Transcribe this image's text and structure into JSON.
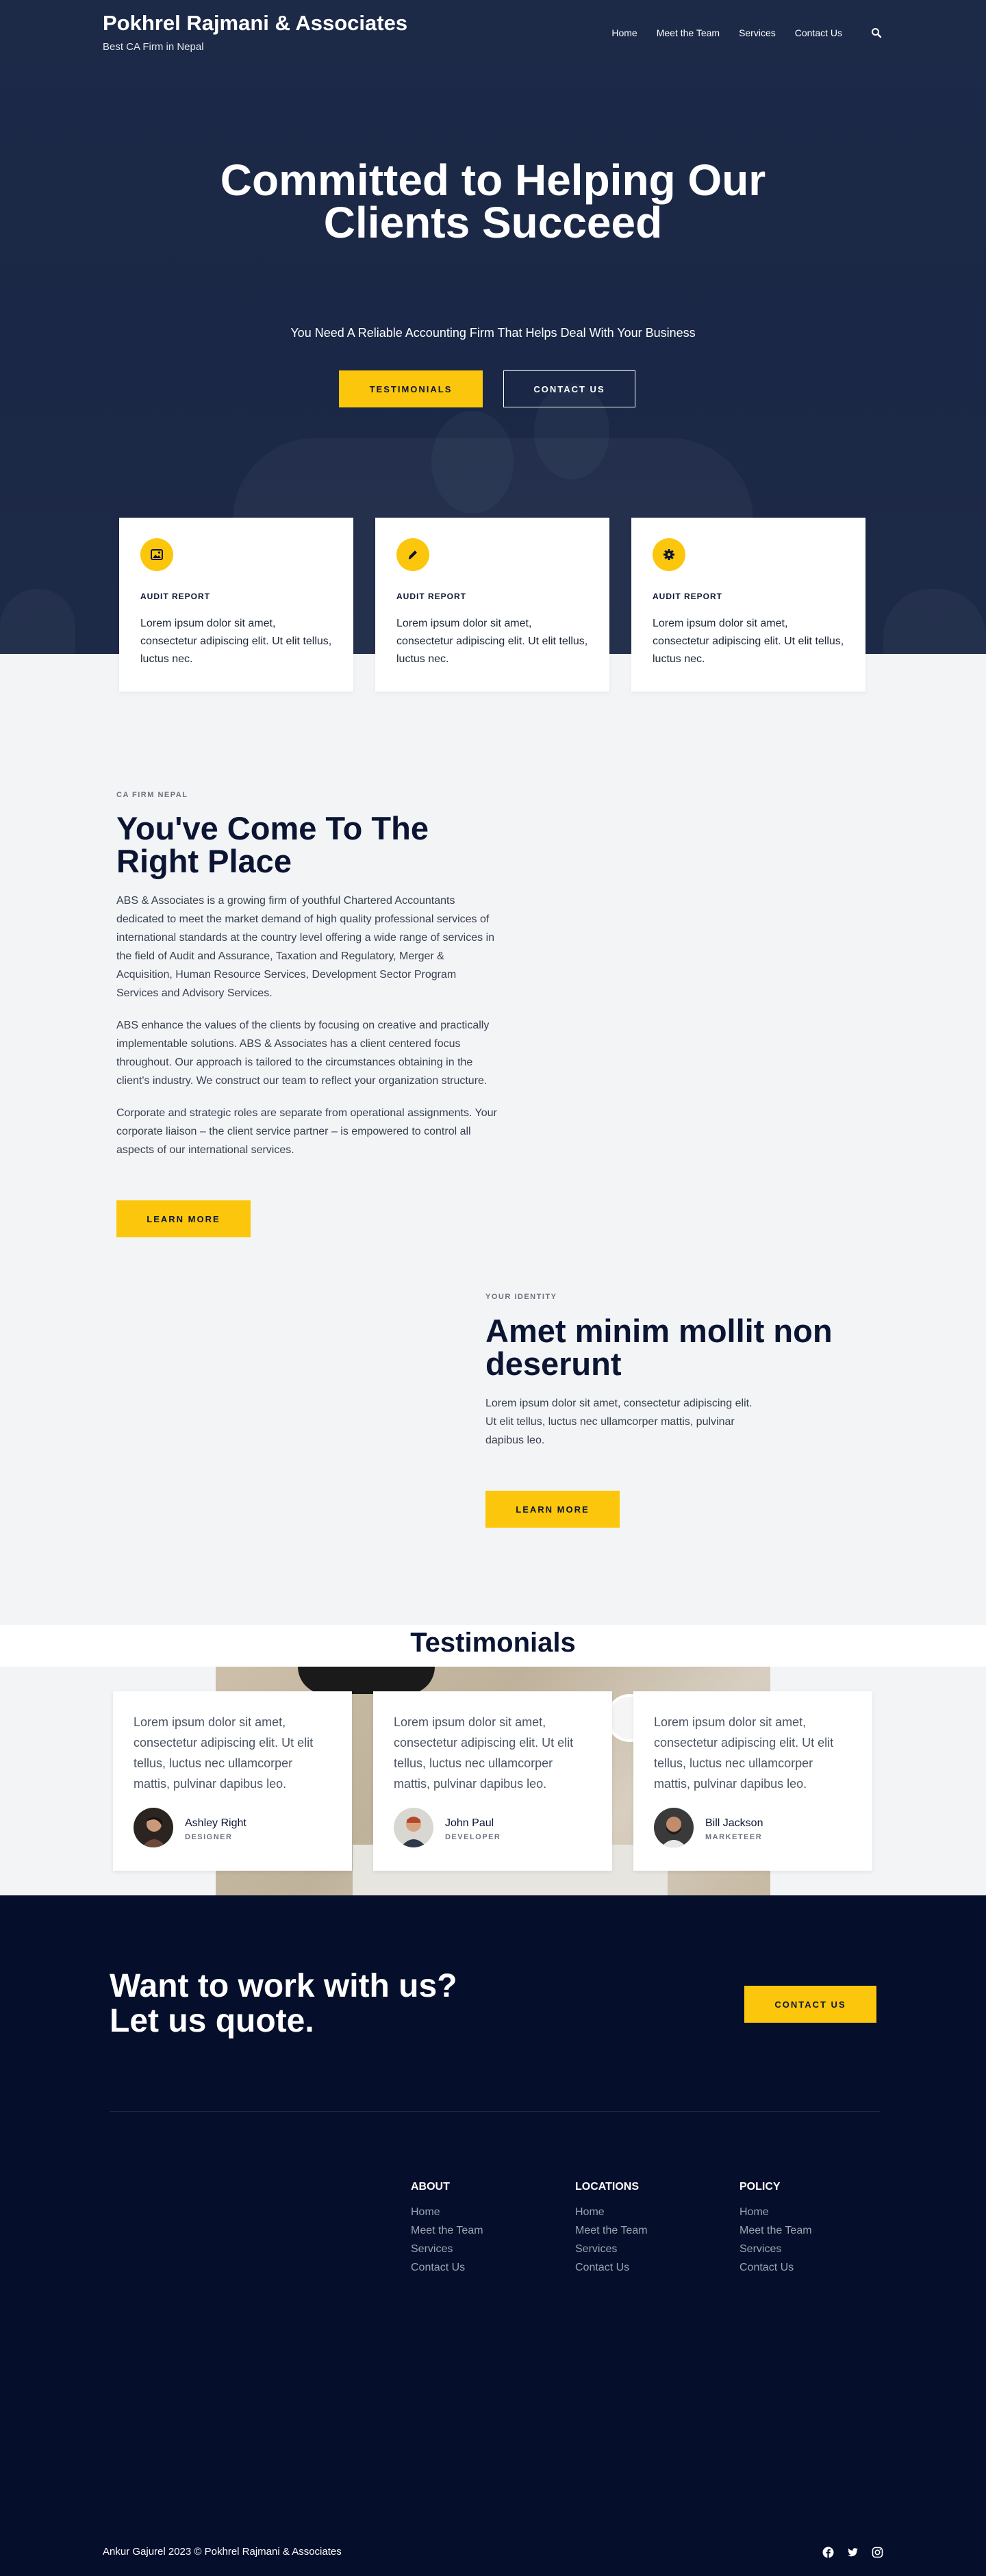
{
  "header": {
    "site_title": "Pokhrel Rajmani & Associates",
    "tagline": "Best CA Firm in Nepal",
    "nav": [
      "Home",
      "Meet the Team",
      "Services",
      "Contact Us"
    ]
  },
  "hero": {
    "title": "Committed to Helping Our Clients Succeed",
    "subtitle": "You Need A Reliable Accounting Firm That Helps Deal With Your Business",
    "btn_testimonials": "TESTIMONIALS",
    "btn_contact": "CONTACT US"
  },
  "features": [
    {
      "icon": "image-icon",
      "label": "AUDIT REPORT",
      "text": "Lorem ipsum dolor sit amet, consectetur adipiscing elit. Ut elit tellus, luctus nec."
    },
    {
      "icon": "pen-icon",
      "label": "AUDIT REPORT",
      "text": "Lorem ipsum dolor sit amet, consectetur adipiscing elit. Ut elit tellus, luctus nec."
    },
    {
      "icon": "gear-icon",
      "label": "AUDIT REPORT",
      "text": "Lorem ipsum dolor sit amet, consectetur adipiscing elit. Ut elit tellus, luctus nec."
    }
  ],
  "about": {
    "eyebrow": "CA FIRM NEPAL",
    "title": "You've Come To The Right Place",
    "p1": "ABS & Associates is a growing firm of youthful Chartered Accountants dedicated to meet the market demand of high quality professional services of international standards at the country level offering a wide range of services in the field of Audit and Assurance, Taxation and Regulatory, Merger & Acquisition, Human Resource Services, Development Sector Program Services and Advisory Services.",
    "p2": "ABS enhance the values of the clients by focusing on creative and practically implementable solutions. ABS & Associates has a client centered focus throughout. Our approach is tailored to the circumstances obtaining in the client's industry. We construct our team to reflect your organization structure.",
    "p3": "Corporate and strategic roles are separate from operational assignments. Your corporate liaison – the client service partner – is empowered to control all aspects of our international services.",
    "button": "LEARN MORE"
  },
  "identity": {
    "eyebrow": "YOUR IDENTITY",
    "title": "Amet minim mollit non deserunt",
    "text": "Lorem ipsum dolor sit amet, consectetur adipiscing elit. Ut elit tellus, luctus nec ullamcorper mattis, pulvinar dapibus leo.",
    "button": "LEARN MORE"
  },
  "testimonials": {
    "title": "Testimonials",
    "items": [
      {
        "quote": "Lorem ipsum dolor sit amet, consectetur adipiscing elit. Ut elit tellus, luctus nec ullamcorper mattis, pulvinar dapibus leo.",
        "name": "Ashley Right",
        "role": "DESIGNER"
      },
      {
        "quote": "Lorem ipsum dolor sit amet, consectetur adipiscing elit. Ut elit tellus, luctus nec ullamcorper mattis, pulvinar dapibus leo.",
        "name": "John Paul",
        "role": "DEVELOPER"
      },
      {
        "quote": "Lorem ipsum dolor sit amet, consectetur adipiscing elit. Ut elit tellus, luctus nec ullamcorper mattis, pulvinar dapibus leo.",
        "name": "Bill Jackson",
        "role": "MARKETEER"
      }
    ]
  },
  "cta": {
    "title": "Want to work with us? Let us quote.",
    "button": "CONTACT US"
  },
  "footer": {
    "columns": [
      {
        "heading": "ABOUT",
        "links": [
          "Home",
          "Meet the Team",
          "Services",
          "Contact Us"
        ]
      },
      {
        "heading": "LOCATIONS",
        "links": [
          "Home",
          "Meet the Team",
          "Services",
          "Contact Us"
        ]
      },
      {
        "heading": "POLICY",
        "links": [
          "Home",
          "Meet the Team",
          "Services",
          "Contact Us"
        ]
      }
    ],
    "copyright": "Ankur Gajurel 2023 © Pokhrel Rajmani & Associates",
    "social": [
      "facebook-icon",
      "twitter-icon",
      "instagram-icon"
    ]
  },
  "colors": {
    "accent": "#fcc60c",
    "navy": "#0b1533",
    "footer_bg": "#050f2c",
    "hero_bg": "#1c2947"
  }
}
